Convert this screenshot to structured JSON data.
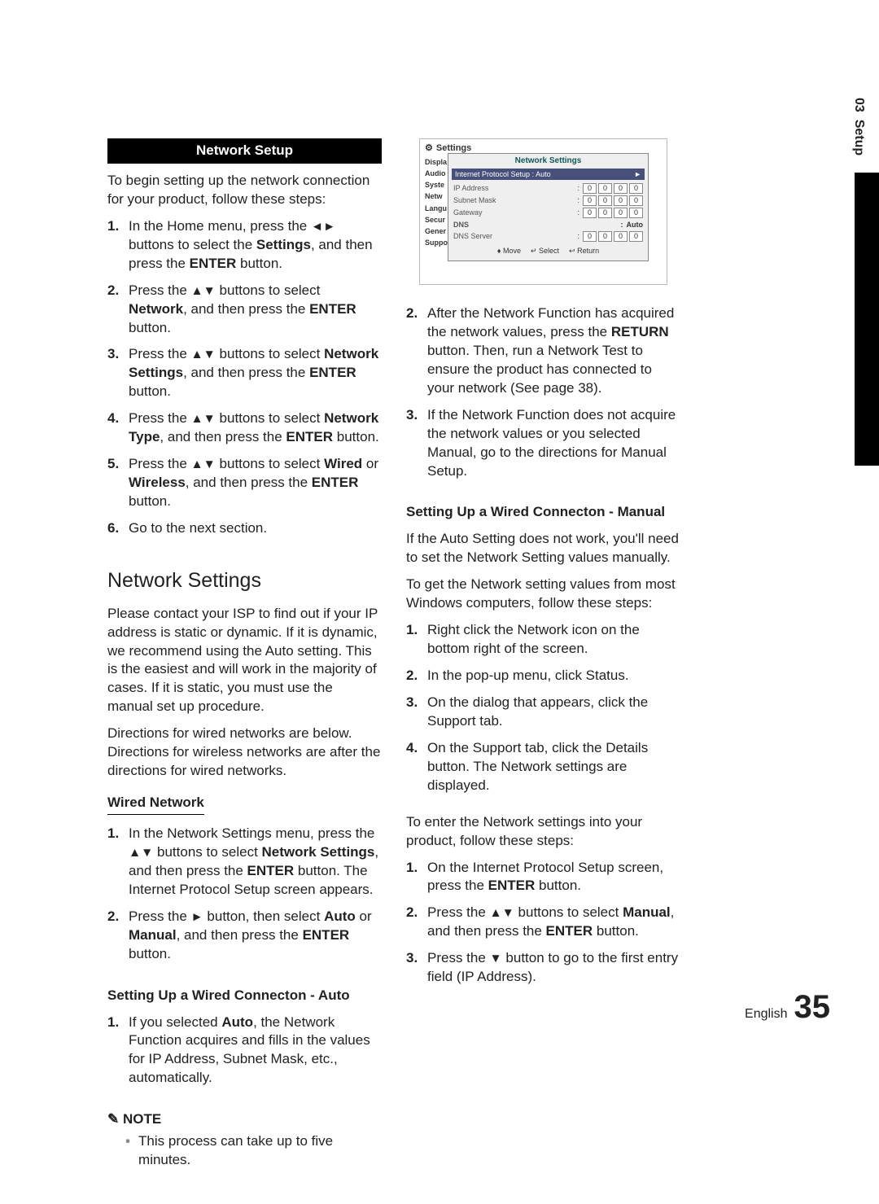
{
  "side": {
    "chapter": "03",
    "title": "Setup"
  },
  "left": {
    "banner": "Network Setup",
    "intro": "To begin setting up the network connection for your product, follow these steps:",
    "steps": [
      {
        "n": "1.",
        "pre": "In the Home menu, press the ",
        "arrows": "◄►",
        "mid": " buttons to select the ",
        "b1": "Settings",
        "post1": ", and then press the ",
        "b2": "ENTER",
        "post2": " button."
      },
      {
        "n": "2.",
        "pre": "Press the ",
        "arrows": "▲▼",
        "mid": " buttons to select ",
        "b1": "Network",
        "post1": ", and then press the ",
        "b2": "ENTER",
        "post2": " button."
      },
      {
        "n": "3.",
        "pre": "Press the ",
        "arrows": "▲▼",
        "mid": " buttons to select ",
        "b1": "Network Settings",
        "post1": ", and then press the ",
        "b2": "ENTER",
        "post2": " button."
      },
      {
        "n": "4.",
        "pre": "Press the ",
        "arrows": "▲▼",
        "mid": " buttons to select ",
        "b1": "Network Type",
        "post1": ", and then press the ",
        "b2": "ENTER",
        "post2": " button."
      },
      {
        "n": "5.",
        "pre": "Press the ",
        "arrows": "▲▼",
        "mid": " buttons to select ",
        "b1": "Wired",
        "post1": " or ",
        "b2": "Wireless",
        "post2a": ", and then press the ",
        "b3": "ENTER",
        "post2": " button."
      },
      {
        "n": "6.",
        "plain": "Go to the next section."
      }
    ],
    "h2": "Network Settings",
    "para1": "Please contact your ISP to find out if your IP address is static or dynamic. If it is dynamic, we recommend using the Auto setting. This is the easiest and will work in the majority of cases. If it is static, you must use the manual set up procedure.",
    "para2": "Directions for wired networks are below. Directions for wireless networks are after the directions for wired networks.",
    "h3": "Wired Network",
    "wired_steps": [
      {
        "n": "1.",
        "pre": "In the Network Settings menu, press the ",
        "arrows": "▲▼",
        "mid": " buttons to select ",
        "b1": "Network Settings",
        "post1": ", and then press the ",
        "b2": "ENTER",
        "post2": " button. The Internet Protocol Setup screen appears."
      },
      {
        "n": "2.",
        "pre": "Press the ",
        "arrows": "►",
        "mid": " button, then select ",
        "b1": "Auto",
        "post1": " or ",
        "b2": "Manual",
        "post2a": ", and then press the ",
        "b3": "ENTER",
        "post2": " button."
      }
    ],
    "h4_auto": "Setting Up a Wired Connecton - Auto",
    "auto_steps": [
      {
        "n": "1.",
        "pre": "If you selected ",
        "b1": "Auto",
        "post": ", the Network Function acquires and fills in the values for IP Address, Subnet Mask, etc., automatically."
      }
    ],
    "note_label": "NOTE",
    "note_text": "This process can take up to five minutes."
  },
  "panel": {
    "top": "Settings",
    "menu": [
      "Displa",
      "Audio",
      "Syste",
      "Netw",
      "Langu",
      "Secur",
      "Gener",
      "Suppo"
    ],
    "title": "Network Settings",
    "sel_label": "Internet Protocol Setup",
    "sel_value": "Auto",
    "rows": [
      {
        "lbl": "IP Address",
        "oct": [
          "0",
          "0",
          "0",
          "0"
        ]
      },
      {
        "lbl": "Subnet Mask",
        "oct": [
          "0",
          "0",
          "0",
          "0"
        ]
      },
      {
        "lbl": "Gateway",
        "oct": [
          "0",
          "0",
          "0",
          "0"
        ]
      }
    ],
    "dns_label": "DNS",
    "dns_value": "Auto",
    "dns_row": {
      "lbl": "DNS Server",
      "oct": [
        "0",
        "0",
        "0",
        "0"
      ]
    },
    "foot": {
      "move": "♦ Move",
      "select": "↵ Select",
      "return": "↩ Return"
    }
  },
  "right": {
    "cont_steps": [
      {
        "n": "2.",
        "pre": "After the Network Function has acquired the network values, press the ",
        "b1": "RETURN",
        "post": " button. Then, run a Network Test to ensure the product has connected to your network (See page 38)."
      },
      {
        "n": "3.",
        "plain": "If the Network Function does not acquire the network values or you selected Manual, go to the directions for Manual Setup."
      }
    ],
    "h4_manual": "Setting Up a Wired Connecton - Manual",
    "m_p1": "If the Auto Setting does not work, you'll need to set the Network Setting values manually.",
    "m_p2": "To get the Network setting values from most Windows computers, follow these steps:",
    "win_steps": [
      {
        "n": "1.",
        "plain": "Right click the Network icon on the bottom right of the screen."
      },
      {
        "n": "2.",
        "plain": "In the pop-up menu, click Status."
      },
      {
        "n": "3.",
        "plain": "On the dialog that appears, click the Support tab."
      },
      {
        "n": "4.",
        "plain": "On the Support tab, click the Details button. The Network settings are displayed."
      }
    ],
    "m_p3": "To enter the Network settings into your product, follow these steps:",
    "enter_steps": [
      {
        "n": "1.",
        "pre": "On the Internet Protocol Setup screen, press the ",
        "b1": "ENTER",
        "post": " button."
      },
      {
        "n": "2.",
        "pre": "Press the ",
        "arrows": "▲▼",
        "mid": " buttons to select ",
        "b1": "Manual",
        "post1": ", and then press the ",
        "b2": "ENTER",
        "post2": " button."
      },
      {
        "n": "3.",
        "pre": "Press the ",
        "arrows": "▼",
        "post": " button to go to the first entry field (IP Address)."
      }
    ]
  },
  "footer": {
    "lang": "English",
    "page": "35"
  }
}
